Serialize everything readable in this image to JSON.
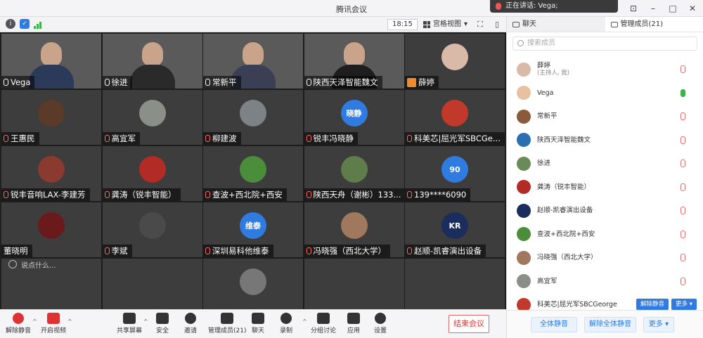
{
  "window": {
    "title": "腾讯会议"
  },
  "speaking": {
    "label": "正在讲话: Vega;"
  },
  "header": {
    "time": "18:15",
    "view_mode": "宫格视图"
  },
  "tiles": [
    {
      "name": "Vega",
      "kind": "video",
      "mic": "on",
      "body": "#2c3a5a"
    },
    {
      "name": "徐进",
      "kind": "video",
      "mic": "on",
      "body": "#2a2a2a"
    },
    {
      "name": "常新平",
      "kind": "video",
      "mic": "on",
      "body": "#3a3f55"
    },
    {
      "name": "陕西天泽智能魏文",
      "kind": "video",
      "mic": "on",
      "body": "#1e1e1e"
    },
    {
      "name": "薛婷",
      "kind": "avatar",
      "mic": "host",
      "avatar_color": "#d9b9a8"
    },
    {
      "name": "王惠民",
      "kind": "avatar",
      "mic": "muted",
      "avatar_color": "#5b3a2a"
    },
    {
      "name": "高宜军",
      "kind": "avatar",
      "mic": "muted",
      "avatar_color": "#8a9088"
    },
    {
      "name": "柳建波",
      "kind": "avatar",
      "mic": "muted",
      "avatar_color": "#7d8287"
    },
    {
      "name": "锐丰冯晓静",
      "kind": "text",
      "mic": "muted",
      "avatar_color": "#2f7be0",
      "avatar_text": "晓静"
    },
    {
      "name": "科美芯|屈光军SBCGe...",
      "kind": "avatar",
      "mic": "muted",
      "avatar_color": "#c0392b"
    },
    {
      "name": "锐丰音响LAX-李建芳",
      "kind": "avatar",
      "mic": "muted",
      "avatar_color": "#8a3a2e"
    },
    {
      "name": "龚涛（锐丰智能）",
      "kind": "avatar",
      "mic": "muted",
      "avatar_color": "#b22b25"
    },
    {
      "name": "查波+西北院+西安",
      "kind": "avatar",
      "mic": "muted",
      "avatar_color": "#4a8d3b"
    },
    {
      "name": "陕西天舟（谢彬）133...",
      "kind": "avatar",
      "mic": "muted",
      "avatar_color": "#5f7d4a"
    },
    {
      "name": "139****6090",
      "kind": "text",
      "mic": "muted",
      "avatar_color": "#2f7be0",
      "avatar_text": "90"
    },
    {
      "name": "董晓明",
      "kind": "avatar",
      "mic": "none",
      "avatar_color": "#6a1a1a"
    },
    {
      "name": "李斌",
      "kind": "avatar",
      "mic": "muted",
      "avatar_color": "#4a4a4a"
    },
    {
      "name": "深圳易科他维泰",
      "kind": "text",
      "mic": "muted",
      "avatar_color": "#2f7be0",
      "avatar_text": "维泰"
    },
    {
      "name": "冯晓强（西北大学）",
      "kind": "avatar",
      "mic": "muted",
      "avatar_color": "#a0785e"
    },
    {
      "name": "赵顺-凯睿演出设备",
      "kind": "avatar",
      "mic": "muted",
      "avatar_color": "#1b2d5c",
      "avatar_text": "KR"
    },
    {
      "name": "",
      "kind": "empty"
    },
    {
      "name": "",
      "kind": "empty"
    },
    {
      "name": "",
      "kind": "phone",
      "avatar_color": "#777"
    },
    {
      "name": "",
      "kind": "empty"
    },
    {
      "name": "",
      "kind": "empty"
    }
  ],
  "chat_input": {
    "placeholder": "说点什么..."
  },
  "toolbar": {
    "unmute": "解除静音",
    "start_video": "开启视频",
    "share": "共享屏幕",
    "security": "安全",
    "invite": "邀请",
    "members": "管理成员(21)",
    "chat": "聊天",
    "record": "录制",
    "breakout": "分组讨论",
    "apps": "应用",
    "settings": "设置",
    "end": "结束会议"
  },
  "panel": {
    "tab_chat": "聊天",
    "tab_members": "管理成员(21)",
    "search_placeholder": "搜索成员",
    "members": [
      {
        "name": "薛婷",
        "sub": "(主持人, 我)",
        "mic": "muted",
        "color": "#d9b9a8"
      },
      {
        "name": "Vega",
        "sub": "",
        "mic": "on",
        "color": "#e8c2a0"
      },
      {
        "name": "常新平",
        "sub": "",
        "mic": "muted",
        "color": "#8a5a3a"
      },
      {
        "name": "陕西天泽智能魏文",
        "sub": "",
        "mic": "muted",
        "color": "#2a6fb0"
      },
      {
        "name": "徐进",
        "sub": "",
        "mic": "muted",
        "color": "#6a8a5a"
      },
      {
        "name": "龚涛（锐丰智能）",
        "sub": "",
        "mic": "muted",
        "color": "#b22b25"
      },
      {
        "name": "赵顺-凯睿演出设备",
        "sub": "",
        "mic": "muted",
        "color": "#1b2d5c"
      },
      {
        "name": "查波+西北院+西安",
        "sub": "",
        "mic": "muted",
        "color": "#4a8d3b"
      },
      {
        "name": "冯晓强（西北大学）",
        "sub": "",
        "mic": "muted",
        "color": "#a0785e"
      },
      {
        "name": "高宜军",
        "sub": "",
        "mic": "muted",
        "color": "#8a9088"
      },
      {
        "name": "科美芯|屈光军SBCGeorge",
        "sub": "",
        "mic": "buttons",
        "color": "#c0392b"
      }
    ],
    "row_btn_unmute": "解除静音",
    "row_btn_more": "更多 ▾",
    "footer_mute_all": "全体静音",
    "footer_unmute_all": "解除全体静音",
    "footer_more": "更多 ▾"
  }
}
